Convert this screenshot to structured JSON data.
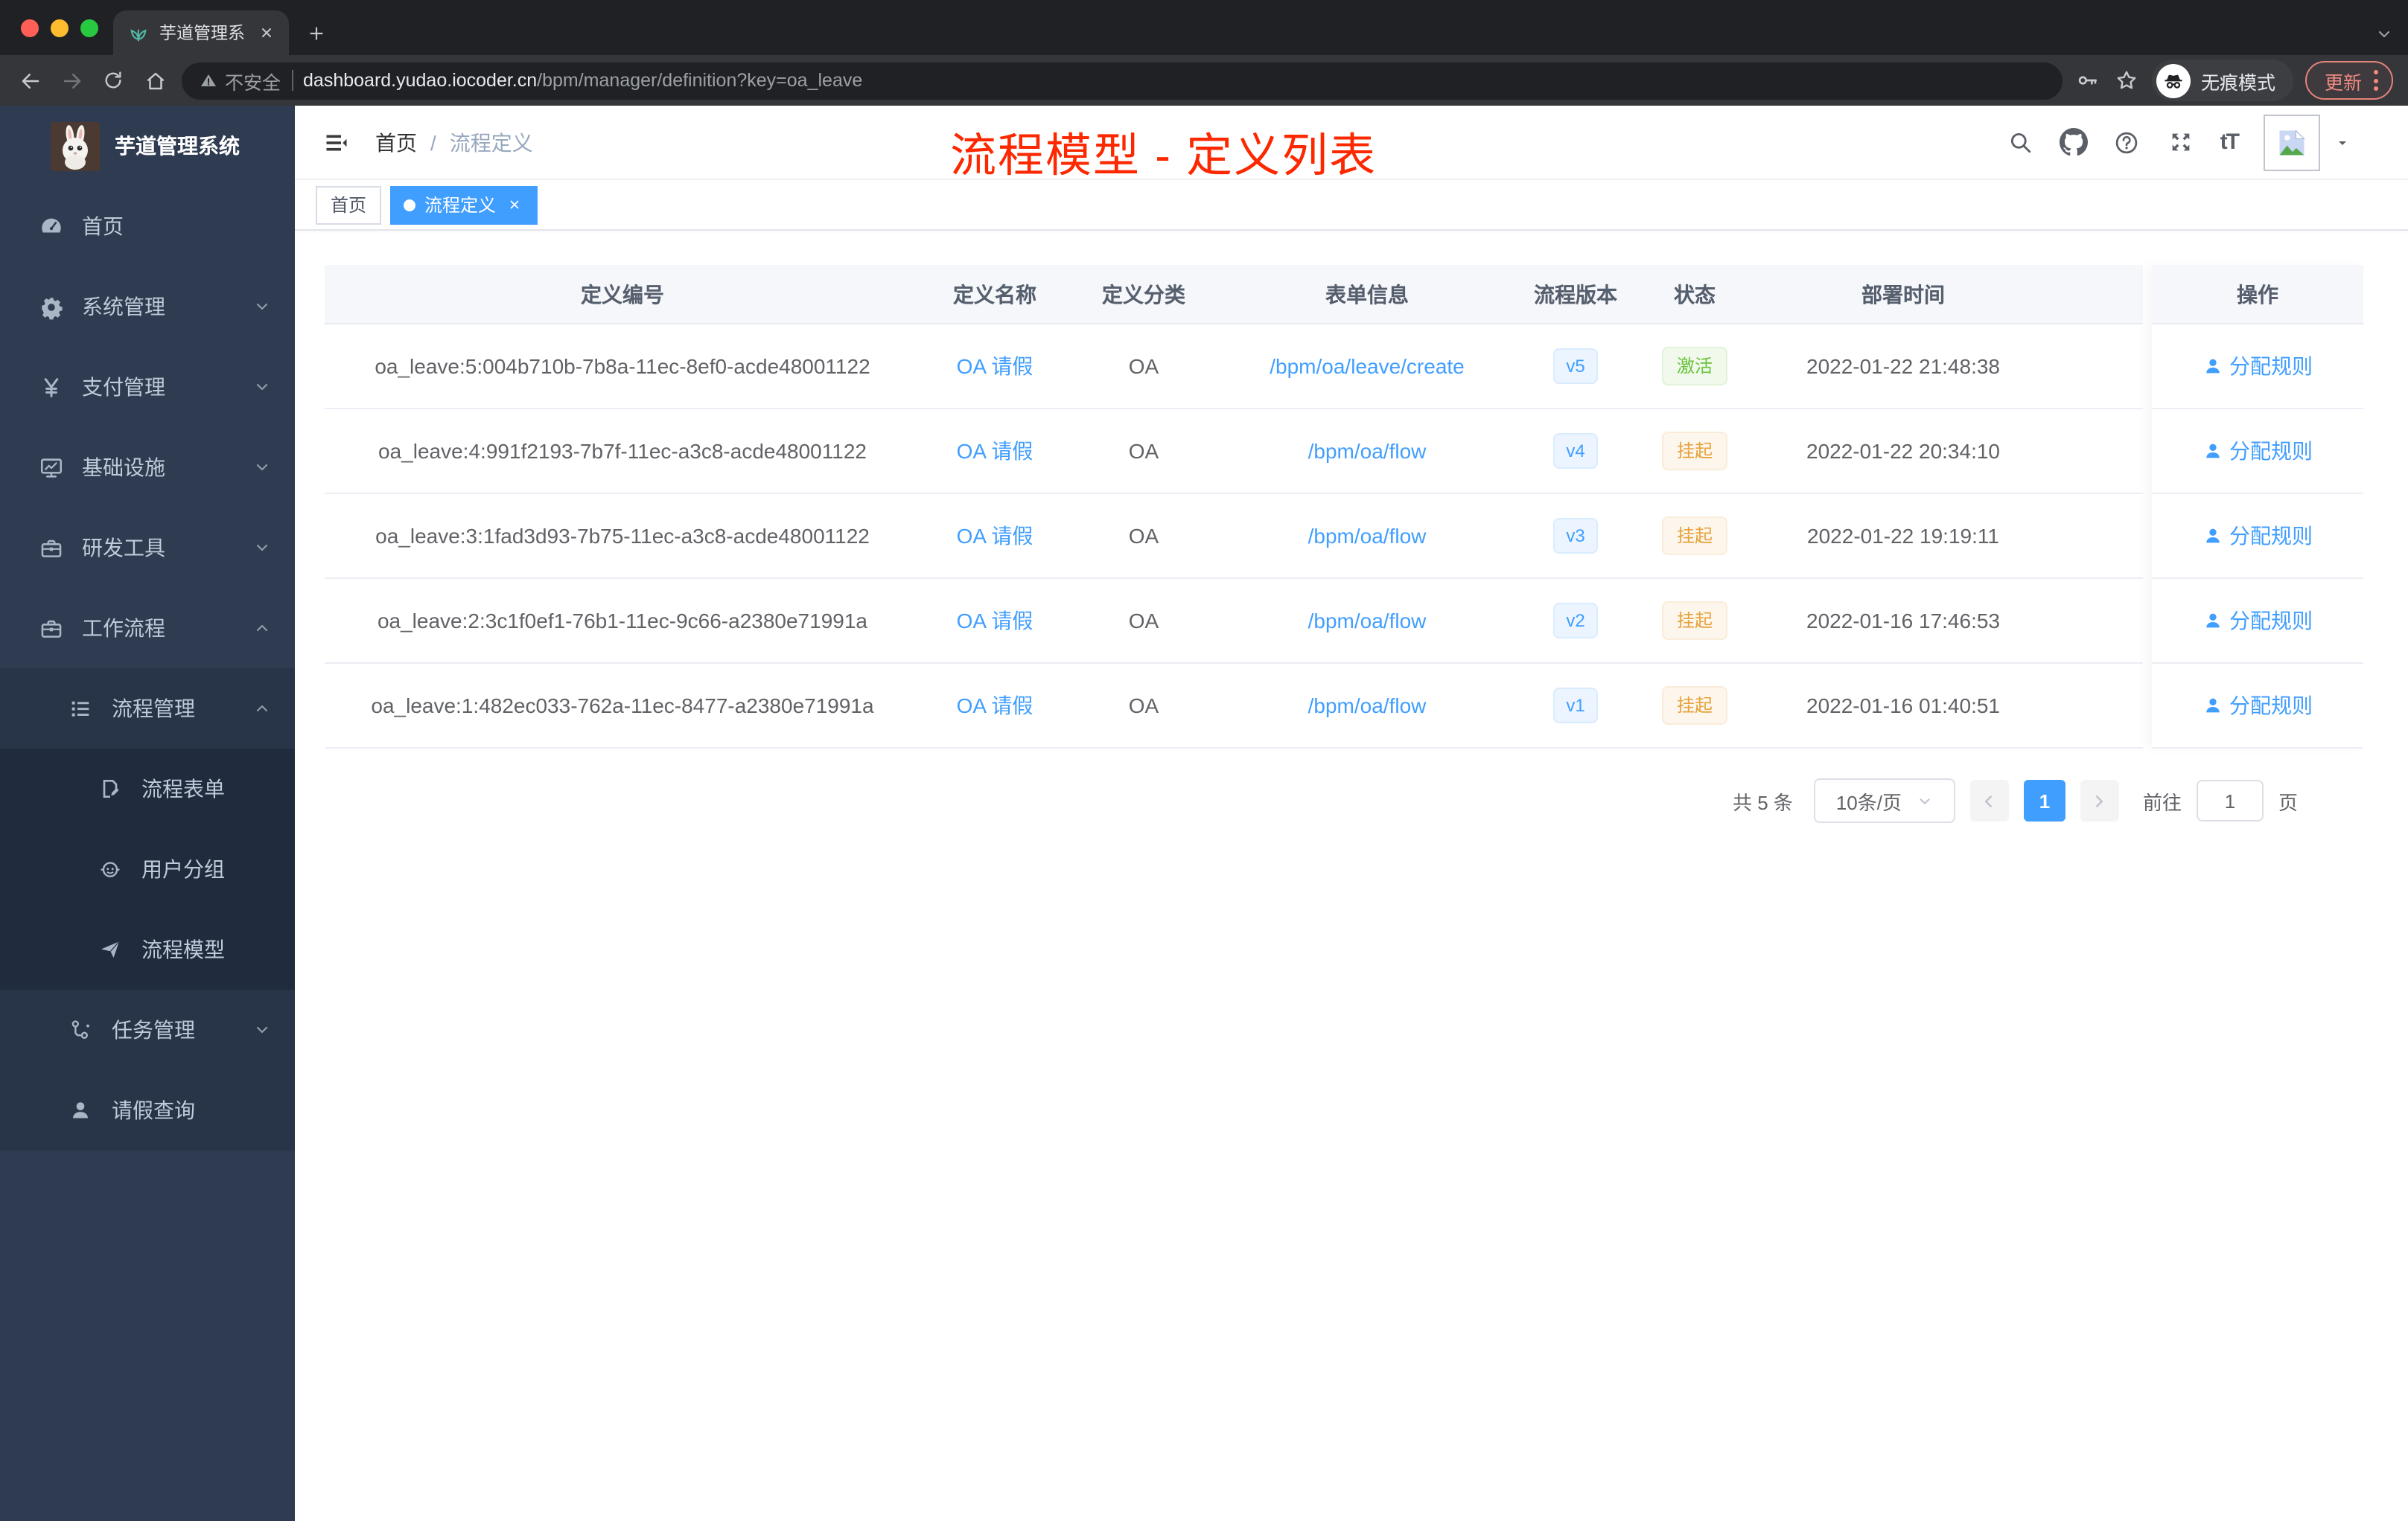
{
  "browser": {
    "tab_title": "芋道管理系统",
    "security_warning": "不安全",
    "url_domain": "dashboard.yudao.iocoder.cn",
    "url_path": "/bpm/manager/definition?key=oa_leave",
    "incognito_label": "无痕模式",
    "update_button": "更新"
  },
  "sidebar": {
    "logo_title": "芋道管理系统",
    "items": [
      {
        "label": "首页",
        "icon": "dashboard-icon"
      },
      {
        "label": "系统管理",
        "icon": "gear-icon"
      },
      {
        "label": "支付管理",
        "icon": "yen-icon"
      },
      {
        "label": "基础设施",
        "icon": "monitor-icon"
      },
      {
        "label": "研发工具",
        "icon": "toolbox-icon"
      },
      {
        "label": "工作流程",
        "icon": "briefcase-icon"
      },
      {
        "label": "流程管理",
        "icon": "list-icon"
      },
      {
        "label": "流程表单",
        "icon": "form-icon"
      },
      {
        "label": "用户分组",
        "icon": "robot-icon"
      },
      {
        "label": "流程模型",
        "icon": "paper-plane-icon"
      },
      {
        "label": "任务管理",
        "icon": "tasks-icon"
      },
      {
        "label": "请假查询",
        "icon": "user-icon"
      }
    ]
  },
  "header": {
    "breadcrumb": {
      "home": "首页",
      "separator": "/",
      "current": "流程定义"
    },
    "annotation_title": "流程模型 - 定义列表",
    "font_icon_text": "tT",
    "right_icons": [
      "search-icon",
      "github-icon",
      "question-icon",
      "fullscreen-icon",
      "font-size-icon",
      "avatar",
      "caret-down-icon"
    ]
  },
  "tags": {
    "home": "首页",
    "active": "流程定义"
  },
  "table": {
    "headers": {
      "id": "定义编号",
      "name": "定义名称",
      "category": "定义分类",
      "form": "表单信息",
      "version": "流程版本",
      "status": "状态",
      "deployed": "部署时间",
      "action": "操作"
    },
    "rows": [
      {
        "id": "oa_leave:5:004b710b-7b8a-11ec-8ef0-acde48001122",
        "name": "OA 请假",
        "category": "OA",
        "form": "/bpm/oa/leave/create",
        "version": "v5",
        "status": "激活",
        "status_type": "success",
        "deployed": "2022-01-22 21:48:38",
        "action": "分配规则"
      },
      {
        "id": "oa_leave:4:991f2193-7b7f-11ec-a3c8-acde48001122",
        "name": "OA 请假",
        "category": "OA",
        "form": "/bpm/oa/flow",
        "version": "v4",
        "status": "挂起",
        "status_type": "warning",
        "deployed": "2022-01-22 20:34:10",
        "action": "分配规则"
      },
      {
        "id": "oa_leave:3:1fad3d93-7b75-11ec-a3c8-acde48001122",
        "name": "OA 请假",
        "category": "OA",
        "form": "/bpm/oa/flow",
        "version": "v3",
        "status": "挂起",
        "status_type": "warning",
        "deployed": "2022-01-22 19:19:11",
        "action": "分配规则"
      },
      {
        "id": "oa_leave:2:3c1f0ef1-76b1-11ec-9c66-a2380e71991a",
        "name": "OA 请假",
        "category": "OA",
        "form": "/bpm/oa/flow",
        "version": "v2",
        "status": "挂起",
        "status_type": "warning",
        "deployed": "2022-01-16 17:46:53",
        "action": "分配规则"
      },
      {
        "id": "oa_leave:1:482ec033-762a-11ec-8477-a2380e71991a",
        "name": "OA 请假",
        "category": "OA",
        "form": "/bpm/oa/flow",
        "version": "v1",
        "status": "挂起",
        "status_type": "warning",
        "deployed": "2022-01-16 01:40:51",
        "action": "分配规则"
      }
    ]
  },
  "pagination": {
    "total": "共 5 条",
    "page_size": "10条/页",
    "current_page": "1",
    "goto_label": "前往",
    "goto_value": "1",
    "page_unit": "页"
  },
  "colors": {
    "accent": "#409eff",
    "success": "#67c23a",
    "warning": "#e6a23c",
    "annotation": "#fb2800",
    "sidebar": "#2f3b50"
  }
}
